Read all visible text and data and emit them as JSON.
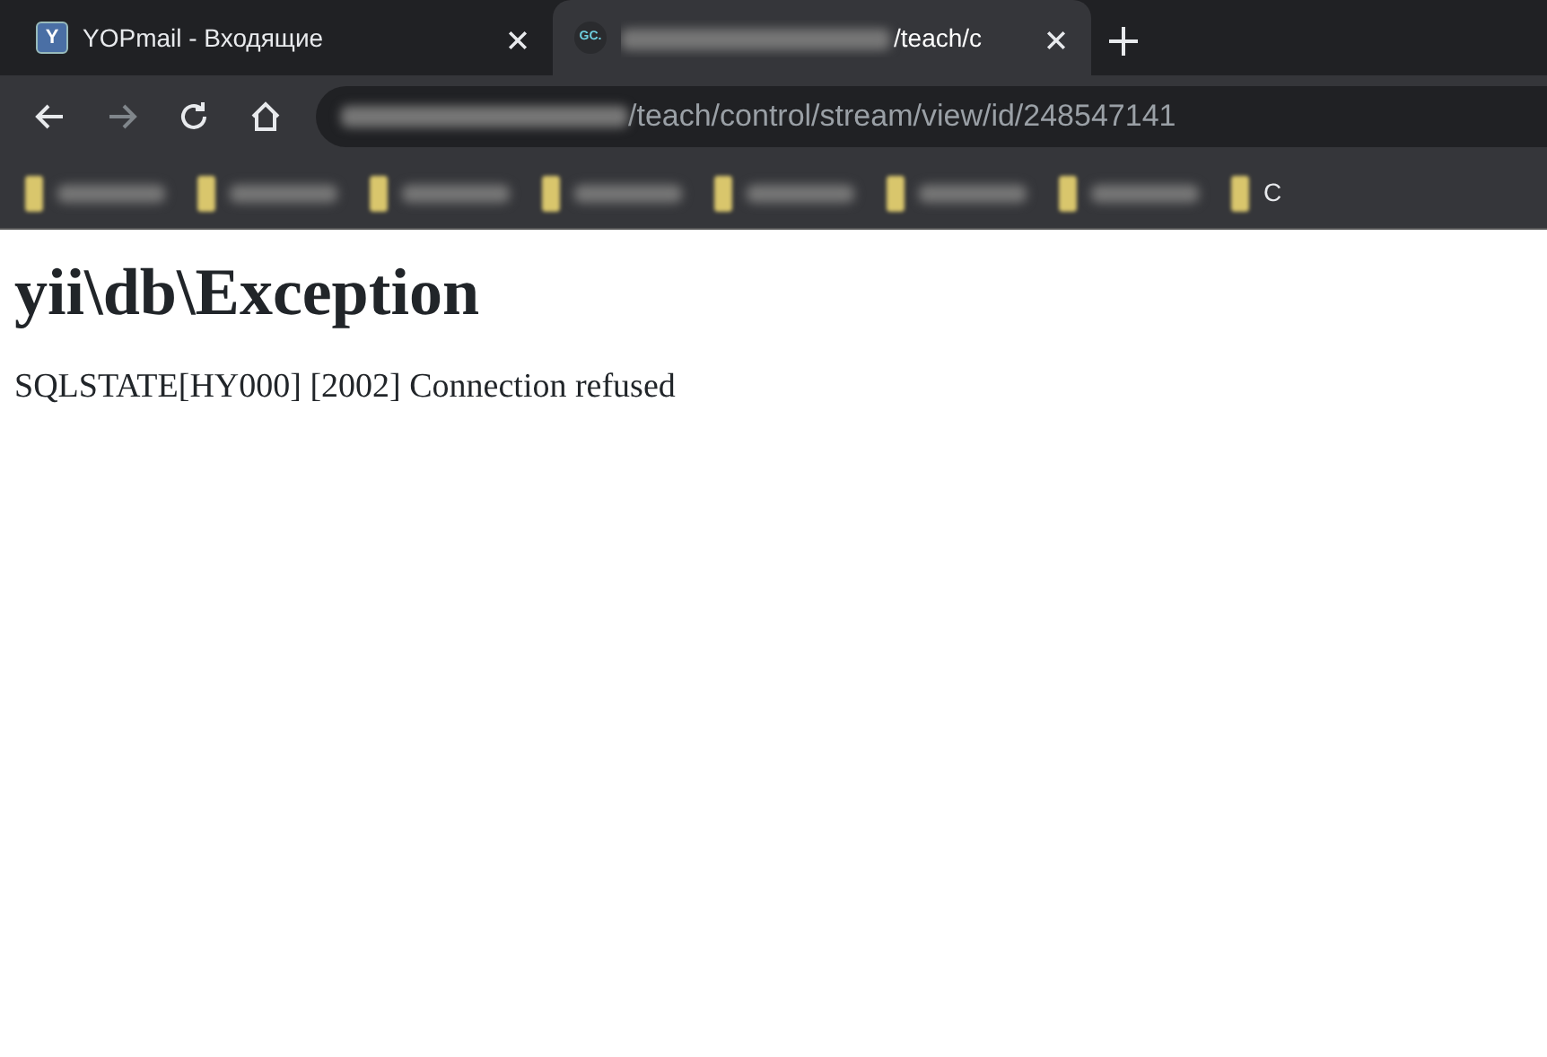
{
  "tabs": [
    {
      "favicon_text": "Y",
      "title": "YOPmail - Входящие",
      "selected": false
    },
    {
      "favicon_text": "GC.",
      "title": "/teach/c",
      "title_blurred_prefix": true,
      "selected": true
    }
  ],
  "toolbar": {
    "back_disabled": false,
    "forward_disabled": true
  },
  "address_bar": {
    "url": "/teach/control/stream/view/id/248547141",
    "host_blurred": true
  },
  "bookmarks": [
    {
      "kind": "redacted"
    },
    {
      "kind": "redacted"
    },
    {
      "kind": "redacted"
    },
    {
      "kind": "redacted"
    },
    {
      "kind": "redacted"
    },
    {
      "kind": "redacted"
    },
    {
      "kind": "redacted"
    },
    {
      "kind": "named",
      "label": "C"
    }
  ],
  "page": {
    "heading": "yii\\db\\Exception",
    "message": "SQLSTATE[HY000] [2002] Connection refused"
  }
}
